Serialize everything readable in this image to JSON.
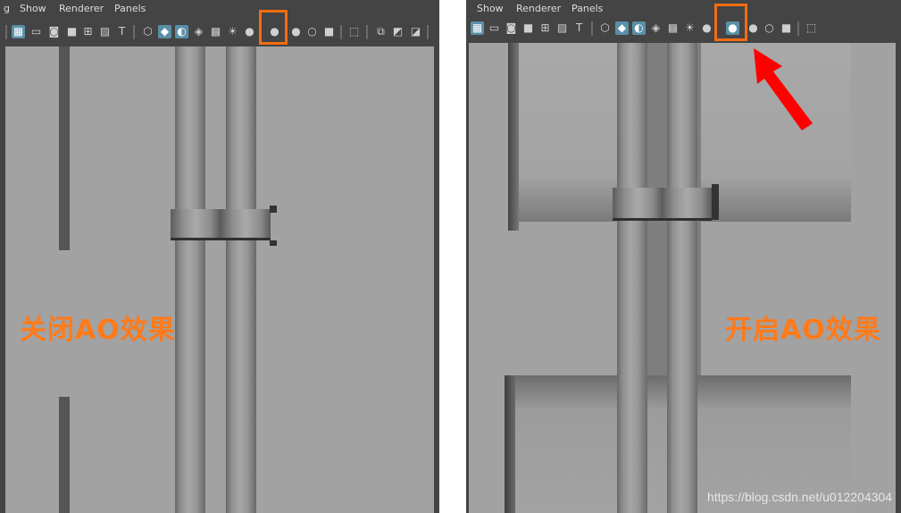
{
  "menu": {
    "item0": "g",
    "show": "Show",
    "renderer": "Renderer",
    "panels": "Panels"
  },
  "icons": [
    "grid-icon",
    "film-gate-icon",
    "camera-icon",
    "resolution-icon",
    "field-chart-icon",
    "image-plane-icon",
    "text-icon",
    "wireframe-icon",
    "smooth-shade-icon",
    "shade-wireframe-icon",
    "textured-icon",
    "checker-icon",
    "lights-icon",
    "shadows-icon",
    "ambient-occlusion-icon",
    "motion-blur-icon",
    "anti-alias-icon",
    "isolate-icon",
    "select-icon",
    "xray-icon",
    "xray-joints-icon",
    "xray-components-icon"
  ],
  "captions": {
    "left": "关闭AO效果",
    "right": "开启AO效果"
  },
  "watermark": "https://blog.csdn.net/u012204304",
  "colors": {
    "highlight": "#f36c12",
    "caption": "#ff7a1a",
    "arrow": "#ff0000",
    "active_icon": "#5a8fa8"
  }
}
